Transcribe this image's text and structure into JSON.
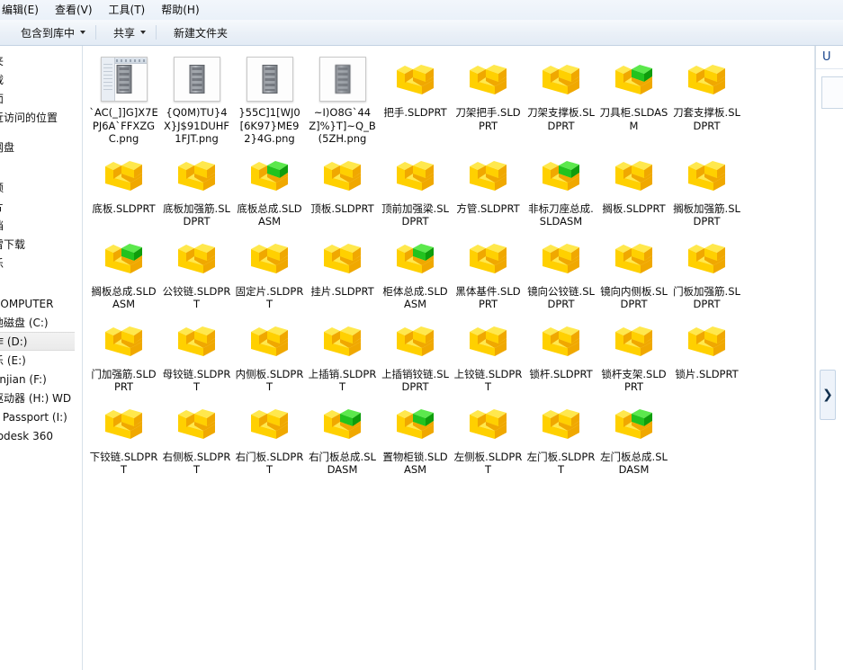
{
  "window": {
    "menubar": [
      {
        "label": "编辑(E)"
      },
      {
        "label": "查看(V)"
      },
      {
        "label": "工具(T)"
      },
      {
        "label": "帮助(H)"
      }
    ],
    "toolbar": [
      {
        "label": "包含到库中",
        "has_caret": true
      },
      {
        "label": "共享",
        "has_caret": true
      },
      {
        "label": "新建文件夹",
        "has_caret": false
      }
    ]
  },
  "sidebar": {
    "items": [
      {
        "label": "夹"
      },
      {
        "label": "载"
      },
      {
        "label": "面"
      },
      {
        "label": "近访问的位置"
      },
      {
        "label": ""
      },
      {
        "label": "网盘"
      },
      {
        "label": ""
      },
      {
        "label": ""
      },
      {
        "label": "频"
      },
      {
        "label": "片"
      },
      {
        "label": "档"
      },
      {
        "label": "雷下载"
      },
      {
        "label": "乐"
      },
      {
        "label": ""
      },
      {
        "label": ""
      },
      {
        "label": "COMPUTER"
      },
      {
        "label": "地磁盘 (C:)"
      },
      {
        "label": "作 (D:)",
        "selected": true
      },
      {
        "label": "乐 (E:)"
      },
      {
        "label": "anjian (F:)"
      },
      {
        "label": "驱动器 (H:) WD"
      },
      {
        "label": "y Passport (I:)"
      },
      {
        "label": "todesk 360"
      }
    ]
  },
  "files": [
    {
      "name": "`AC(_]]G]X7EPJ6A`FFXZGC.png",
      "type": "png-thumb-ui"
    },
    {
      "name": "{Q0M)TU}4X}J$91DUHF1FJT.png",
      "type": "png-thumb"
    },
    {
      "name": "}55C]1[WJ0[6K97}ME92}4G.png",
      "type": "png-thumb"
    },
    {
      "name": "~I)O8G`44Z]%}T]~Q_B(5ZH.png",
      "type": "png-thumb-blur"
    },
    {
      "name": "把手.SLDPRT",
      "type": "sldprt"
    },
    {
      "name": "刀架把手.SLDPRT",
      "type": "sldprt"
    },
    {
      "name": "刀架支撑板.SLDPRT",
      "type": "sldprt"
    },
    {
      "name": "刀具柜.SLDASM",
      "type": "sldasm"
    },
    {
      "name": "刀套支撑板.SLDPRT",
      "type": "sldprt"
    },
    {
      "name": "底板.SLDPRT",
      "type": "sldprt"
    },
    {
      "name": "底板加强筋.SLDPRT",
      "type": "sldprt"
    },
    {
      "name": "底板总成.SLDASM",
      "type": "sldasm"
    },
    {
      "name": "顶板.SLDPRT",
      "type": "sldprt"
    },
    {
      "name": "顶前加强梁.SLDPRT",
      "type": "sldprt"
    },
    {
      "name": "方管.SLDPRT",
      "type": "sldprt"
    },
    {
      "name": "非标刀座总成.SLDASM",
      "type": "sldasm"
    },
    {
      "name": "搁板.SLDPRT",
      "type": "sldprt"
    },
    {
      "name": "搁板加强筋.SLDPRT",
      "type": "sldprt"
    },
    {
      "name": "搁板总成.SLDASM",
      "type": "sldasm"
    },
    {
      "name": "公铰链.SLDPRT",
      "type": "sldprt"
    },
    {
      "name": "固定片.SLDPRT",
      "type": "sldprt"
    },
    {
      "name": "挂片.SLDPRT",
      "type": "sldprt"
    },
    {
      "name": "柜体总成.SLDASM",
      "type": "sldasm"
    },
    {
      "name": "黑体基件.SLDPRT",
      "type": "sldprt"
    },
    {
      "name": "镜向公铰链.SLDPRT",
      "type": "sldprt"
    },
    {
      "name": "镜向内侧板.SLDPRT",
      "type": "sldprt"
    },
    {
      "name": "门板加强筋.SLDPRT",
      "type": "sldprt"
    },
    {
      "name": "门加强筋.SLDPRT",
      "type": "sldprt"
    },
    {
      "name": "母铰链.SLDPRT",
      "type": "sldprt"
    },
    {
      "name": "内侧板.SLDPRT",
      "type": "sldprt"
    },
    {
      "name": "上插销.SLDPRT",
      "type": "sldprt"
    },
    {
      "name": "上插销铰链.SLDPRT",
      "type": "sldprt"
    },
    {
      "name": "上铰链.SLDPRT",
      "type": "sldprt"
    },
    {
      "name": "锁杆.SLDPRT",
      "type": "sldprt"
    },
    {
      "name": "锁杆支架.SLDPRT",
      "type": "sldprt"
    },
    {
      "name": "锁片.SLDPRT",
      "type": "sldprt"
    },
    {
      "name": "下铰链.SLDPRT",
      "type": "sldprt"
    },
    {
      "name": "右侧板.SLDPRT",
      "type": "sldprt"
    },
    {
      "name": "右门板.SLDPRT",
      "type": "sldprt"
    },
    {
      "name": "右门板总成.SLDASM",
      "type": "sldasm"
    },
    {
      "name": "置物柜锁.SLDASM",
      "type": "sldasm"
    },
    {
      "name": "左侧板.SLDPRT",
      "type": "sldprt"
    },
    {
      "name": "左门板.SLDPRT",
      "type": "sldprt"
    },
    {
      "name": "左门板总成.SLDASM",
      "type": "sldasm"
    }
  ],
  "details_pane": {
    "title": "U",
    "expand_icon": "❯"
  },
  "colors": {
    "part_yellow": "#ffd400",
    "assembly_green": "#22c31e",
    "chrome_blue": "#e3ebf5",
    "selection_gray": "#eaeaea"
  }
}
